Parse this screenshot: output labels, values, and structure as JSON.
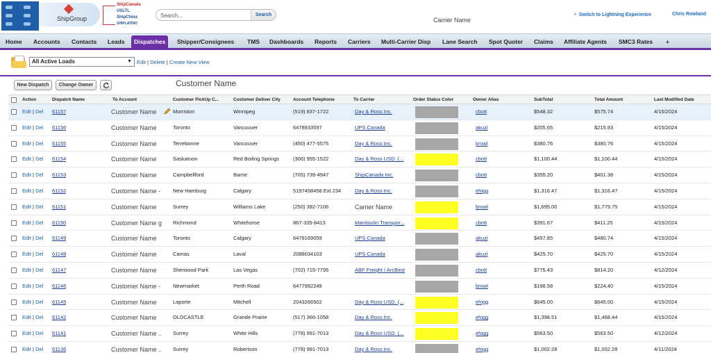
{
  "header": {
    "brands": [
      "ShipCanada",
      "USLTL",
      "ShipChina",
      "SHIPLATINO"
    ],
    "brand_name": "ShipGroup",
    "search_placeholder": "Search...",
    "search_button": "Search",
    "carrier_name": "Carrier Name",
    "lightning_link": "Switch to Lightning Experience",
    "user_name": "Chris Rowland"
  },
  "nav": {
    "tabs": [
      {
        "label": "Home"
      },
      {
        "label": "Accounts"
      },
      {
        "label": "Contacts"
      },
      {
        "label": "Leads"
      },
      {
        "label": "Dispatches",
        "active": true
      },
      {
        "label": "Shipper/Consignees"
      },
      {
        "label": "TMS"
      },
      {
        "label": "Dashboards"
      },
      {
        "label": "Reports"
      },
      {
        "label": "Carriers"
      },
      {
        "label": "Multi-Carrier Disp"
      },
      {
        "label": "Lane Search"
      },
      {
        "label": "Spot Quoter"
      },
      {
        "label": "Claims"
      },
      {
        "label": "Affiliate Agents"
      },
      {
        "label": "SMC3 Rates"
      },
      {
        "label": "+"
      }
    ]
  },
  "view": {
    "selected": "All Active Loads",
    "edit": "Edit",
    "delete": "Delete",
    "create": "Create New View",
    "sep": "|"
  },
  "actions": {
    "new_dispatch": "New Dispatch",
    "change_owner": "Change Owner",
    "refresh_icon": "refresh-icon",
    "customer_name": "Customer Name"
  },
  "columns": [
    "Action",
    "Dispatch Name",
    "To Account",
    "Customer PickUp C...",
    "Customer Deliver City",
    "Account Telephone",
    "To Carrier",
    "Order Status Color",
    "Owner Alias",
    "SubTotal",
    "Total Amount",
    "Last Modified Date"
  ],
  "row_action": {
    "edit": "Edit",
    "sep": "|",
    "del": "Del"
  },
  "colors": {
    "gray": "#a7a7a7",
    "yellow": "#ffff22",
    "accent": "#6b2fa6"
  },
  "rows": [
    {
      "dispatch": "61157",
      "account": "Customer Name",
      "pickup": "Morriston",
      "deliver": "Winnipeg",
      "phone": "(519) 837-1722",
      "carrier": "Day & Ross Inc.",
      "status": "gray",
      "owner": "cbott",
      "subtotal": "$548.32",
      "total": "$575.74",
      "date": "4/15/2024",
      "selected": true
    },
    {
      "dispatch": "61156",
      "account": "Customer Name",
      "pickup": "Toronto",
      "deliver": "Vancouver",
      "phone": "6478933597",
      "carrier": "UPS Canada",
      "status": "gray",
      "owner": "akuzi",
      "subtotal": "$205.65",
      "total": "$215.93",
      "date": "4/15/2024"
    },
    {
      "dispatch": "61155",
      "account": "Customer Name",
      "pickup": "Terrebonne",
      "deliver": "Vancouver",
      "phone": "(450) 477-5575",
      "carrier": "Day & Ross Inc.",
      "status": "gray",
      "owner": "krowl",
      "subtotal": "$380.76",
      "total": "$380.76",
      "date": "4/15/2024"
    },
    {
      "dispatch": "61154",
      "account": "Customer Name",
      "pickup": "Saskatoon",
      "deliver": "Red Boiling Springs",
      "phone": "(306) 955-1522",
      "carrier": "Day & Ross USD. (...",
      "status": "yellow",
      "owner": "cbott",
      "subtotal": "$1,100.44",
      "total": "$1,100.44",
      "date": "4/15/2024"
    },
    {
      "dispatch": "61153",
      "account": "Customer Name",
      "pickup": "Campbellford",
      "deliver": "Barrie",
      "phone": "(705) 739-4947",
      "carrier": "ShipCanada Inc.",
      "status": "gray",
      "owner": "cbott",
      "subtotal": "$355.20",
      "total": "$401.38",
      "date": "4/15/2024"
    },
    {
      "dispatch": "61152",
      "account": "Customer Name -",
      "pickup": "New Hamburg",
      "deliver": "Calgary",
      "phone": "5197458458 Ext 234",
      "carrier": "Day & Ross Inc.",
      "status": "gray",
      "owner": "ehigg",
      "subtotal": "$1,316.47",
      "total": "$1,316.47",
      "date": "4/15/2024"
    },
    {
      "dispatch": "61151",
      "account": "Customer Name",
      "pickup": "Surrey",
      "deliver": "Williams Lake",
      "phone": "(250) 392-7106",
      "carrier": "Carrier Name",
      "carrier_plain": true,
      "status": "yellow",
      "owner": "browl",
      "subtotal": "$1,695.00",
      "total": "$1,779.75",
      "date": "4/15/2024"
    },
    {
      "dispatch": "61150",
      "account": "Customer Name g",
      "pickup": "Richmond",
      "deliver": "Whitehorse",
      "phone": "867-335-8413",
      "carrier": "Manitoulin Transpor...",
      "status": "yellow",
      "owner": "cbott",
      "subtotal": "$391.67",
      "total": "$411.25",
      "date": "4/15/2024"
    },
    {
      "dispatch": "61149",
      "account": "Customer Name",
      "pickup": "Toronto",
      "deliver": "Calgary",
      "phone": "6479169059",
      "carrier": "UPS Canada",
      "status": "gray",
      "owner": "akuzi",
      "subtotal": "$457.85",
      "total": "$480.74",
      "date": "4/15/2024"
    },
    {
      "dispatch": "61148",
      "account": "Customer Name",
      "pickup": "Camas",
      "deliver": "Laval",
      "phone": "2088034103",
      "carrier": "UPS Canada",
      "status": "gray",
      "owner": "akuzi",
      "subtotal": "$425.70",
      "total": "$425.70",
      "date": "4/15/2024"
    },
    {
      "dispatch": "61147",
      "account": "Customer Name",
      "pickup": "Sherwood Park",
      "deliver": "Las Vegas",
      "phone": "(702) 715-7795",
      "carrier": "ABF Freight / ArcBest",
      "status": "gray",
      "owner": "cbott",
      "subtotal": "$775.43",
      "total": "$814.20",
      "date": "4/12/2024"
    },
    {
      "dispatch": "61146",
      "account": "Customer Name -",
      "pickup": "Newmarket",
      "deliver": "Perth Road",
      "phone": "6477992249",
      "carrier": "",
      "status": "gray",
      "owner": "browl",
      "subtotal": "$198.58",
      "total": "$224.40",
      "date": "4/15/2024"
    },
    {
      "dispatch": "61145",
      "account": "Customer Name",
      "pickup": "Laporte",
      "deliver": "Mitchell",
      "phone": "2043266502",
      "carrier": "Day & Ross USD. (...",
      "status": "yellow",
      "owner": "ehigg",
      "subtotal": "$645.00",
      "total": "$645.00",
      "date": "4/15/2024"
    },
    {
      "dispatch": "61142",
      "account": "Customer Name",
      "pickup": "OLDCASTLE",
      "deliver": "Grande Prairie",
      "phone": "(517) 366-1058",
      "carrier": "Day & Ross Inc.",
      "status": "yellow",
      "owner": "ehigg",
      "subtotal": "$1,398.51",
      "total": "$1,468.44",
      "date": "4/15/2024"
    },
    {
      "dispatch": "61141",
      "account": "Customer Name ..",
      "pickup": "Surrey",
      "deliver": "White Hills",
      "phone": "(778) 991-7013",
      "carrier": "Day & Ross USD. (...",
      "status": "yellow",
      "owner": "ehigg",
      "subtotal": "$563.50",
      "total": "$563.50",
      "date": "4/12/2024"
    },
    {
      "dispatch": "61136",
      "account": "Customer Name ..",
      "pickup": "Surrey",
      "deliver": "Robertson",
      "phone": "(778) 991-7013",
      "carrier": "Day & Ross Inc.",
      "status": "gray",
      "owner": "ehigg",
      "subtotal": "$1,002.28",
      "total": "$1,002.28",
      "date": "4/11/2024"
    }
  ]
}
